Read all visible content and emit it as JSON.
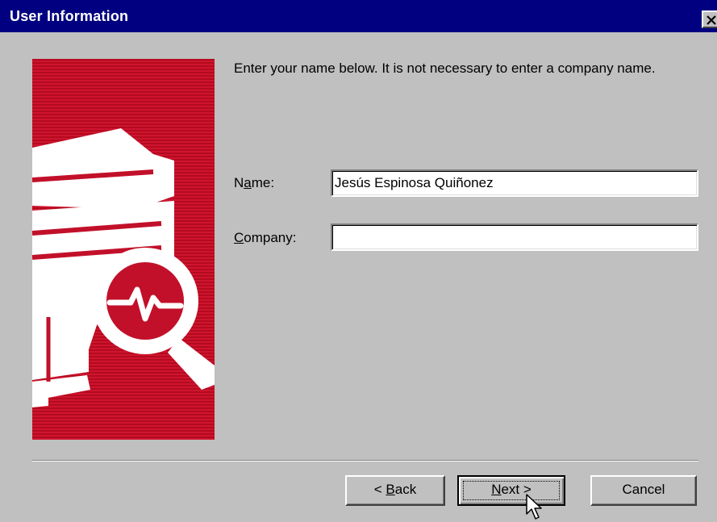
{
  "window": {
    "title": "User Information"
  },
  "intro_text": "Enter your name below.  It is not necessary to enter a company name.",
  "form": {
    "name_label_pre": "N",
    "name_label_accel": "a",
    "name_label_post": "me:",
    "name_value": "Jesús Espinosa Quiñonez",
    "company_label_pre": "",
    "company_label_accel": "C",
    "company_label_post": "ompany:",
    "company_value": ""
  },
  "buttons": {
    "back_pre": "< ",
    "back_accel": "B",
    "back_post": "ack",
    "next_accel": "N",
    "next_post": "ext >",
    "cancel": "Cancel"
  },
  "colors": {
    "title_bar": "#000080",
    "dialog_bg": "#c0c0c0",
    "banner_red": "#c2102a"
  },
  "icons": {
    "close": "close-x-icon",
    "banner": "server-diagnostic-magnifier-icon",
    "cursor": "mouse-pointer-icon"
  }
}
